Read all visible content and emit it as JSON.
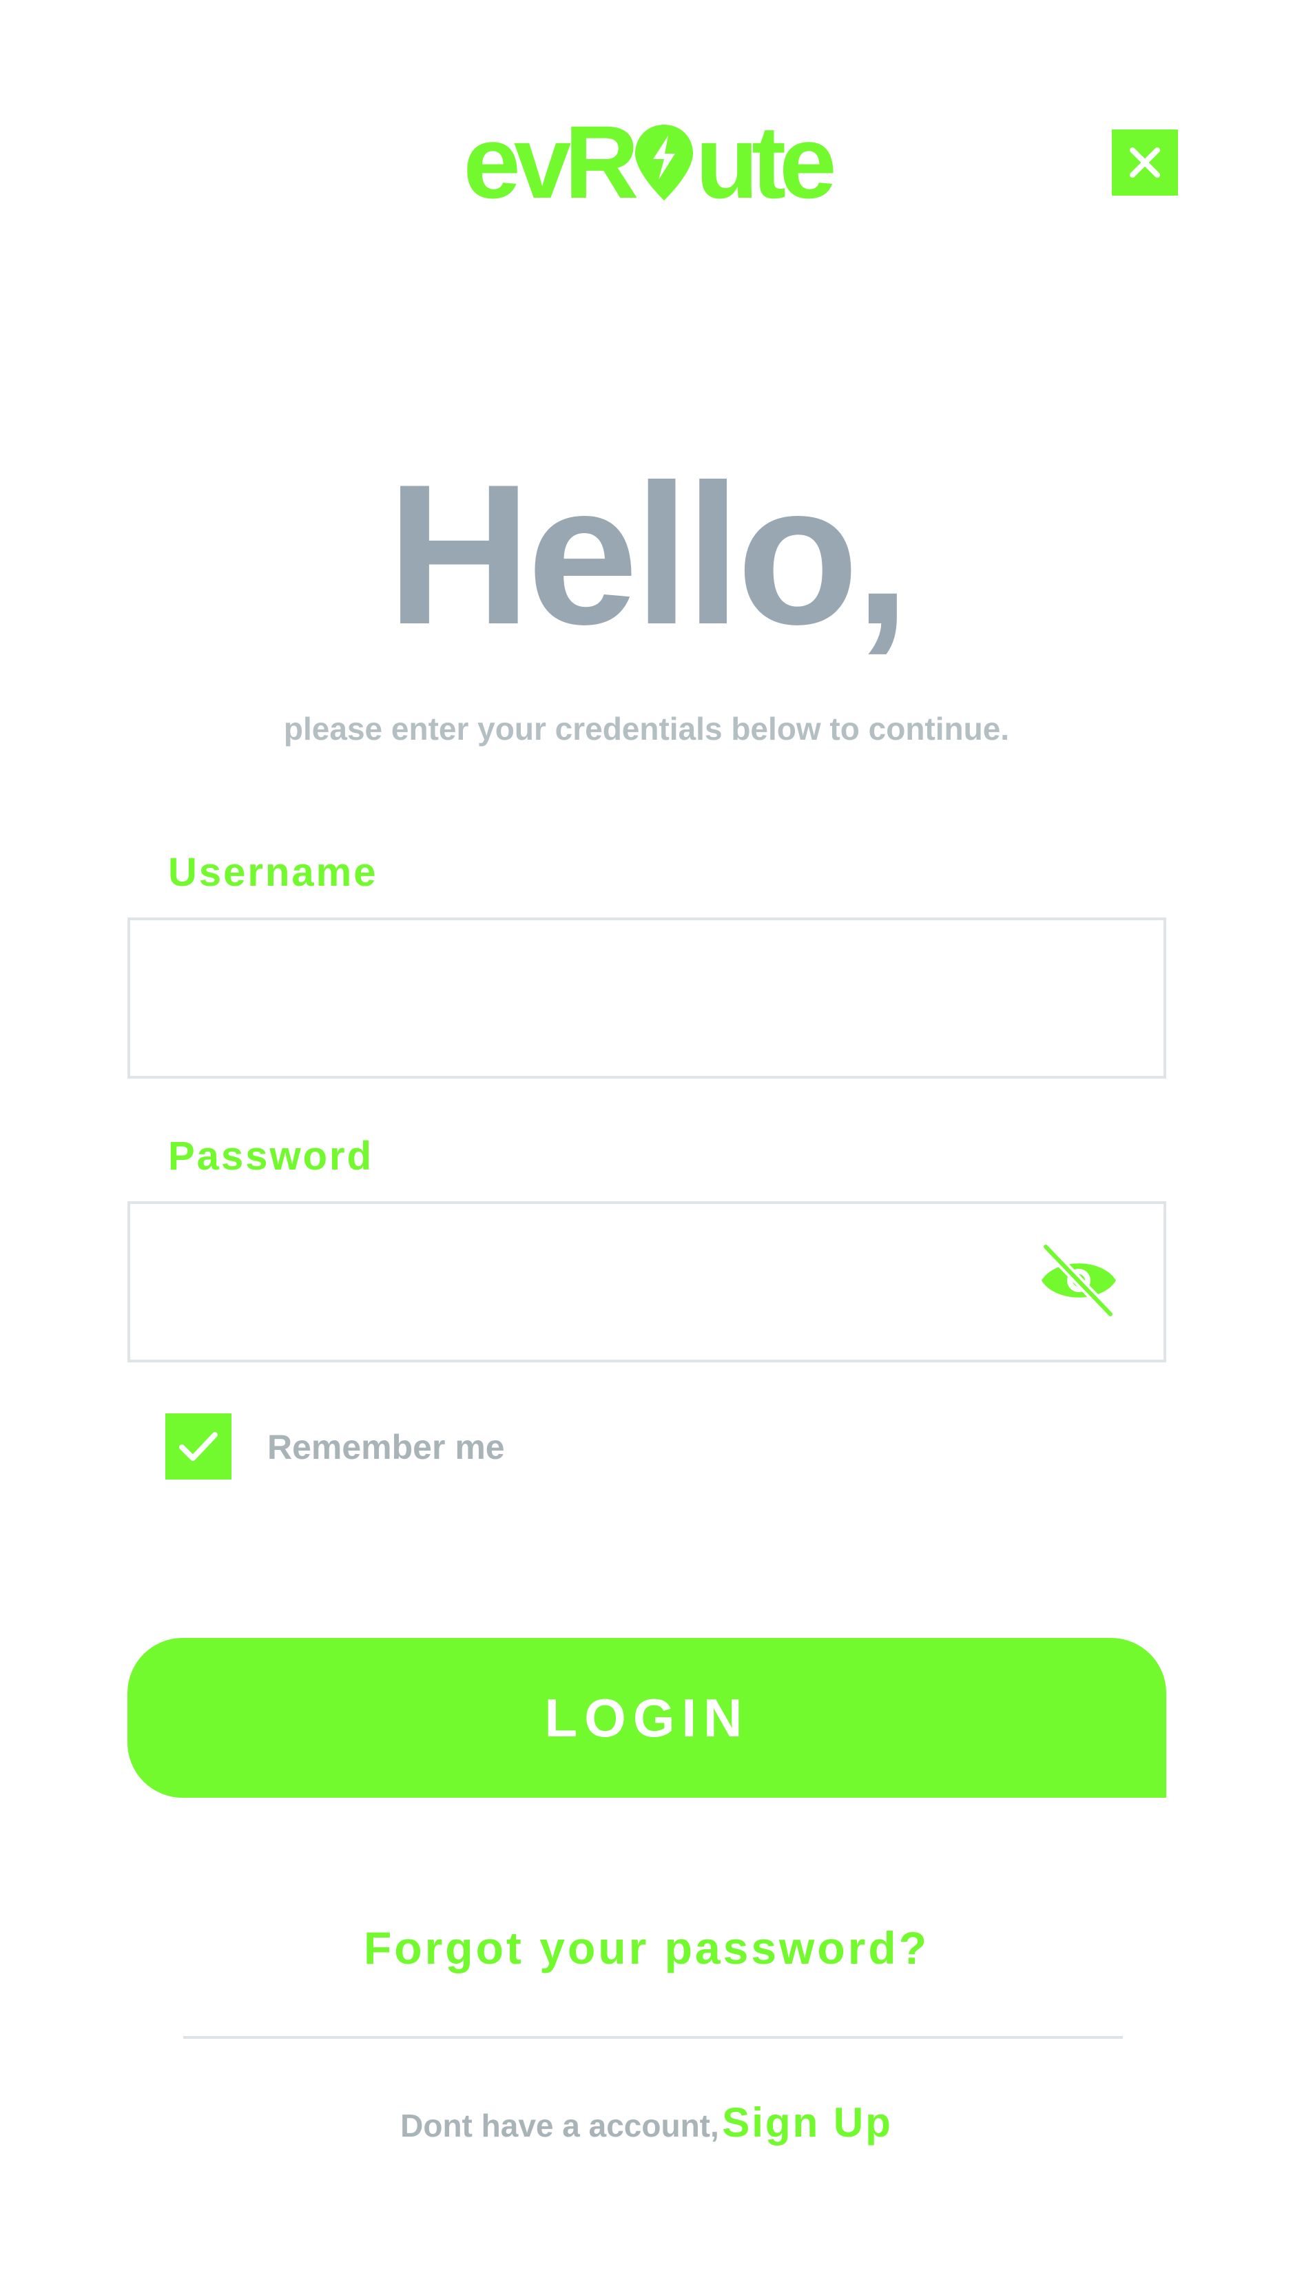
{
  "brand": {
    "logo_text_before": "evR",
    "logo_text_after": "ute",
    "accent_color": "#72fa2f"
  },
  "header": {
    "close_icon": "close-icon"
  },
  "greeting": {
    "title": "Hello,",
    "subtitle": "please enter your credentials below to continue."
  },
  "form": {
    "username": {
      "label": "Username",
      "value": "",
      "placeholder": ""
    },
    "password": {
      "label": "Password",
      "value": "",
      "placeholder": "",
      "visibility_icon": "eye-slash-icon"
    },
    "remember_me": {
      "label": "Remember me",
      "checked": true,
      "icon": "checkmark-icon"
    },
    "login_label": "LOGIN"
  },
  "footer": {
    "forgot_password": "Forgot your password?",
    "signup_prompt": "Dont have a account,",
    "signup_link": "Sign Up"
  },
  "colors": {
    "title_gray": "#98a7b2",
    "muted_text": "#a9b4b9",
    "border": "#dfe4e6"
  }
}
